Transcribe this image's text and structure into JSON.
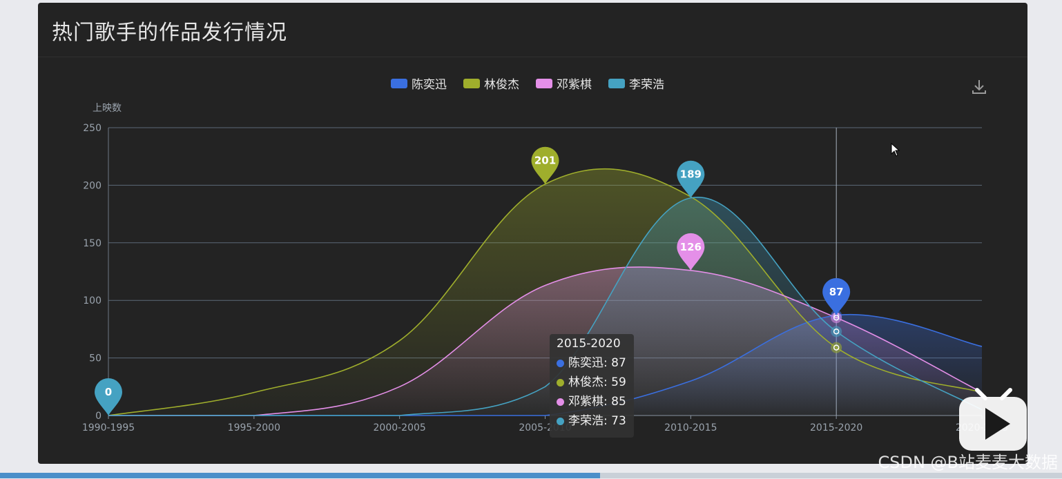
{
  "panel": {
    "title": "热门歌手的作品发行情况",
    "download_icon": "download-icon"
  },
  "chart_data": {
    "type": "area",
    "categories": [
      "1990-1995",
      "1995-2000",
      "2000-2005",
      "2005-2010",
      "2010-2015",
      "2015-2020",
      "2020-2025"
    ],
    "ylabel": "上映数",
    "ylim": [
      0,
      250
    ],
    "yticks": [
      0,
      50,
      100,
      150,
      200,
      250
    ],
    "grid": true,
    "legend_position": "top-center",
    "series": [
      {
        "name": "陈奕迅",
        "color": "#3a6fe0",
        "values": [
          0,
          0,
          0,
          0,
          30,
          87,
          60
        ],
        "max_label": "87",
        "max_index": 5
      },
      {
        "name": "林俊杰",
        "color": "#9fae2c",
        "values": [
          0,
          20,
          65,
          201,
          190,
          59,
          20
        ],
        "max_label": "201",
        "max_index": 3
      },
      {
        "name": "邓紫棋",
        "color": "#e48fe8",
        "values": [
          0,
          0,
          25,
          113,
          126,
          85,
          20
        ],
        "max_label": "126",
        "max_index": 4
      },
      {
        "name": "李荣浩",
        "color": "#45a2c2",
        "values": [
          0,
          0,
          0,
          25,
          189,
          73,
          5
        ],
        "max_label": "189",
        "max_index": 4,
        "min_label": "0",
        "min_index": 0
      }
    ]
  },
  "tooltip": {
    "title": "2015-2020",
    "rows": [
      {
        "label": "陈奕迅: 87",
        "color": "#3a6fe0"
      },
      {
        "label": "林俊杰: 59",
        "color": "#9fae2c"
      },
      {
        "label": "邓紫棋: 85",
        "color": "#e48fe8"
      },
      {
        "label": "李荣浩: 73",
        "color": "#45a2c2"
      }
    ]
  },
  "player": {
    "progress_fraction": 0.565,
    "play_icon": "play-icon"
  },
  "footer": {
    "credit": "CSDN @B站麦麦大数据"
  }
}
